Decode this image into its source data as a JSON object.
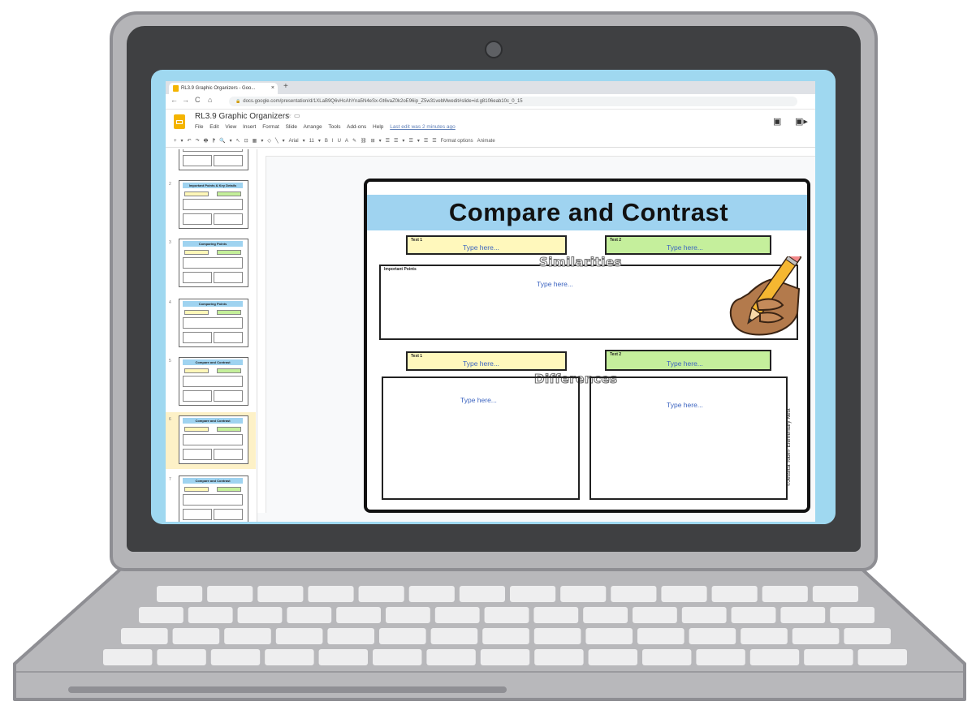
{
  "browser": {
    "tab_title": "RL3.9 Graphic Organizers - Goo...",
    "tab_close": "×",
    "new_tab": "+",
    "back": "←",
    "forward": "→",
    "reload": "C",
    "home": "⌂",
    "lock": "🔒",
    "url": "docs.google.com/presentation/d/1XLaB9Q6vHcAhYna5N4eSx-Gt6vaZ0k2oE96ip_Z5w31vebMwedit#slide=id.g8106eab10c_0_15"
  },
  "docs": {
    "title": "RL3.9 Graphic Organizers",
    "star": "☆",
    "folder": "▭",
    "menu": [
      "File",
      "Edit",
      "View",
      "Insert",
      "Format",
      "Slide",
      "Arrange",
      "Tools",
      "Add-ons",
      "Help"
    ],
    "last_edit": "Last edit was 2 minutes ago",
    "comment": "▣",
    "present": "▣▸",
    "toolbar": [
      "+",
      "▾",
      "↶",
      "↷",
      "🖶",
      "⁋",
      "🔍",
      "▾",
      "↖",
      "⊡",
      "▦",
      "▾",
      "◇",
      "╲",
      "▾",
      "Arial",
      "▾",
      "11",
      "▾",
      "B",
      "I",
      "U",
      "A",
      "✎",
      "⛓",
      "⊞",
      "▾",
      "☰",
      "☰",
      "▾",
      "☰",
      "▾",
      "☰",
      "☰",
      "Format options",
      "Animate"
    ]
  },
  "thumbnails": [
    {
      "num": "",
      "title": ""
    },
    {
      "num": "2",
      "title": "Important Points & Key Details"
    },
    {
      "num": "3",
      "title": "Comparing Points"
    },
    {
      "num": "4",
      "title": "Comparing Points"
    },
    {
      "num": "5",
      "title": "Compare and Contrast"
    },
    {
      "num": "6",
      "title": "Compare and Contrast"
    },
    {
      "num": "7",
      "title": "Compare and Contrast"
    }
  ],
  "slide": {
    "title": "Compare and Contrast",
    "text1_label": "Text 1",
    "text2_label": "Text 2",
    "type_here": "Type here...",
    "similarities": "Similarities",
    "important_points": "Important Points",
    "differences": "Differences",
    "copyright": "©Jessica Tobin- Elementary Nest"
  },
  "colors": {
    "banner": "#9fd3f0",
    "text1_box": "#fff8bc",
    "text2_box": "#c5ef9c",
    "type_here": "#3c64c0",
    "screen_bg": "#9fd8f0"
  }
}
